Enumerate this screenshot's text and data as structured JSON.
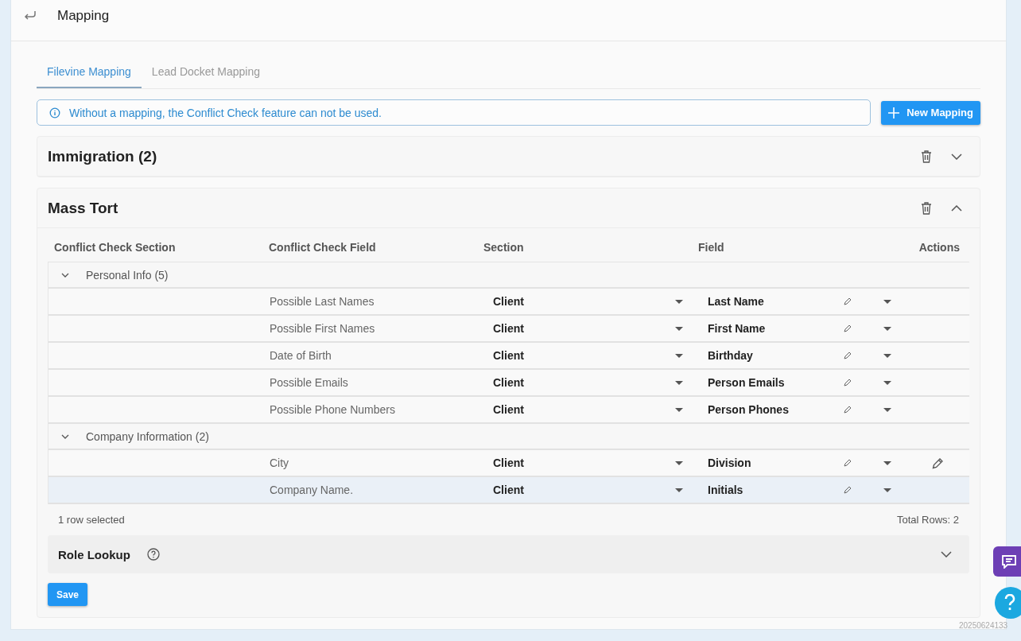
{
  "header": {
    "title": "Mapping"
  },
  "tabs": [
    {
      "label": "Filevine Mapping",
      "selected": true
    },
    {
      "label": "Lead Docket Mapping",
      "selected": false
    }
  ],
  "alert": {
    "text": "Without a mapping, the Conflict Check feature can not be used."
  },
  "new_button": {
    "label": "New Mapping"
  },
  "panels": [
    {
      "title": "Immigration (2)",
      "expanded": false
    },
    {
      "title": "Mass Tort",
      "expanded": true
    }
  ],
  "table": {
    "columns": [
      "Conflict Check Section",
      "Conflict Check Field",
      "Section",
      "Field",
      "Actions"
    ],
    "groups": [
      {
        "label": "Personal Info (5)",
        "expanded": true,
        "rows": [
          {
            "field": "Possible Last Names",
            "section": "Client",
            "target": "Last Name",
            "selected": false,
            "hovered": false
          },
          {
            "field": "Possible First Names",
            "section": "Client",
            "target": "First Name",
            "selected": false,
            "hovered": false
          },
          {
            "field": "Date of Birth",
            "section": "Client",
            "target": "Birthday",
            "selected": false,
            "hovered": false
          },
          {
            "field": "Possible Emails",
            "section": "Client",
            "target": "Person Emails",
            "selected": false,
            "hovered": false
          },
          {
            "field": "Possible Phone Numbers",
            "section": "Client",
            "target": "Person Phones",
            "selected": false,
            "hovered": false
          }
        ]
      },
      {
        "label": "Company Information (2)",
        "expanded": true,
        "rows": [
          {
            "field": "City",
            "section": "Client",
            "target": "Division",
            "selected": false,
            "hovered": true
          },
          {
            "field": "Company Name.",
            "section": "Client",
            "target": "Initials",
            "selected": true,
            "hovered": false
          }
        ]
      }
    ],
    "selected_text": "1 row selected",
    "total_text": "Total Rows: 2"
  },
  "role_lookup": {
    "title": "Role Lookup",
    "expanded": false
  },
  "save_button": {
    "label": "Save"
  },
  "timestamp": "20250624133"
}
